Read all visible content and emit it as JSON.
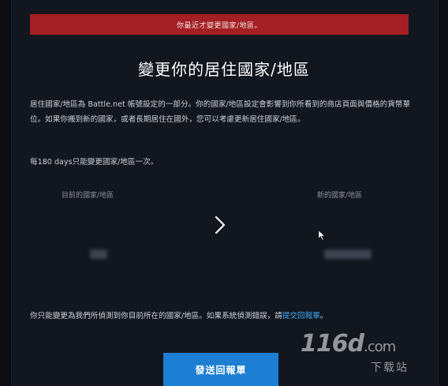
{
  "banner": {
    "text": "你最近才變更國家/地區。"
  },
  "page": {
    "title": "變更你的居住國家/地區",
    "description": "居住國家/地區為 Battle.net 帳號設定的一部分。你的國家/地區設定會影響到你所看到的商店頁面與價格的貨幣單位。如果你搬到新的國家，或者長期居住在國外，您可以考慮更新居住國家/地區。",
    "limit": "每180 days只能變更國家/地區一次。"
  },
  "region": {
    "current_label": "目前的國家/地區",
    "new_label": "新的國家/地區"
  },
  "footer": {
    "note_prefix": "你只能變更為我們所偵測到你目前所在的國家/地區。如果系統偵測錯誤，請",
    "note_link": "提交回報單",
    "note_suffix": "。",
    "submit_label": "發送回報單"
  },
  "watermark": {
    "main": "116d",
    "com": ".com",
    "sub": "下载站"
  },
  "colors": {
    "banner": "#a41f24",
    "button": "#1c7fd4",
    "link": "#3fa7f2",
    "background": "#12161f"
  },
  "icons": {
    "arrow": "chevron-right-icon",
    "cursor": "mouse-cursor-icon"
  }
}
